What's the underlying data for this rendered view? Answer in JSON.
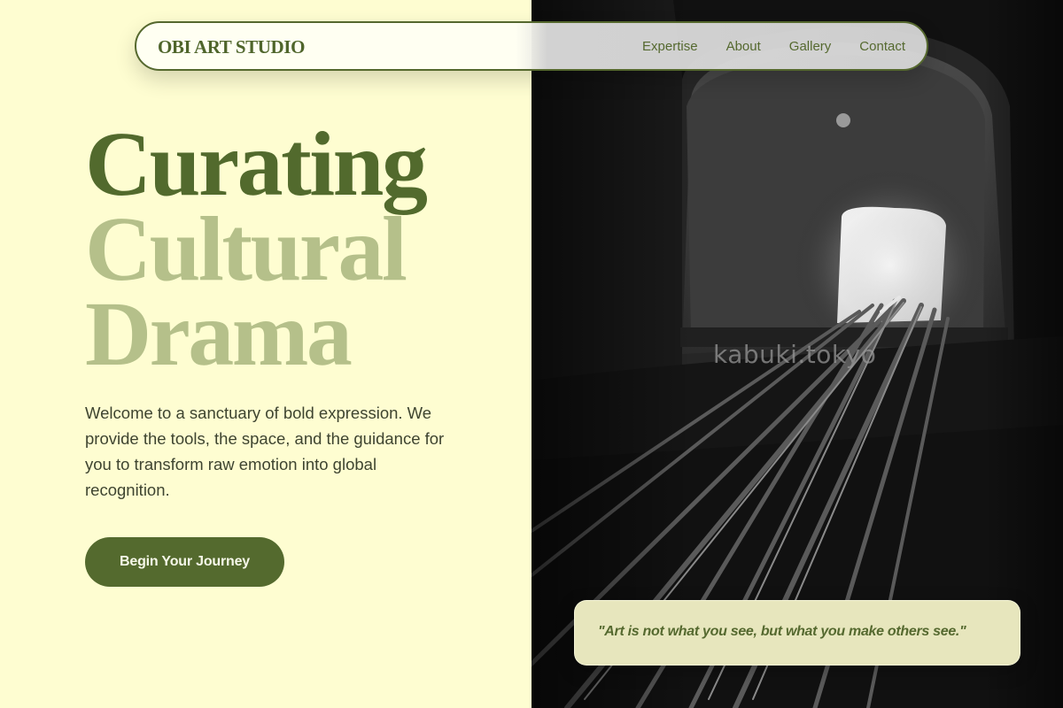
{
  "brand": {
    "name": "OBI ART STUDIO"
  },
  "nav": {
    "links": [
      {
        "label": "Expertise"
      },
      {
        "label": "About"
      },
      {
        "label": "Gallery"
      },
      {
        "label": "Contact"
      }
    ]
  },
  "hero": {
    "title_lines": [
      "Curating",
      "Cultural",
      "Drama"
    ],
    "description": "Welcome to a sanctuary of bold expression. We provide the tools, the space, and the guidance for you to transform raw emotion into global recognition.",
    "cta_label": "Begin Your Journey"
  },
  "image": {
    "watermark": "kabuki.tokyo"
  },
  "quote": {
    "text": "\"Art is not what you see, but what you make others see.\""
  },
  "colors": {
    "background": "#fefdd1",
    "primary_green": "#546a2e",
    "light_green": "#b5c08a",
    "quote_card": "#e7e6bd"
  }
}
